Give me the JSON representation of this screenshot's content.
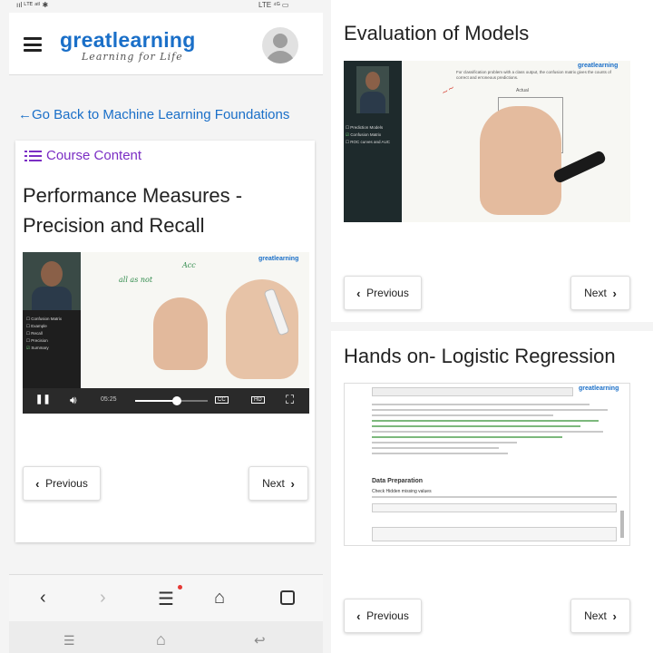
{
  "status_bar": {
    "left": "ııl ᴸᵀᴱ ᵃᵗˡ ✱",
    "right": "LTE ⁴ᴳ ▭"
  },
  "app": {
    "brand_name": "greatlearning",
    "brand_tagline": "Learning for Life",
    "menu_icon": "hamburger-icon",
    "avatar_icon": "user-avatar-icon"
  },
  "back_link": {
    "icon": "arrow-left-icon",
    "label": "Go Back to Machine Learning Foundations"
  },
  "course_content": {
    "icon": "list-icon",
    "label": "Course Content"
  },
  "lesson": {
    "title_line1": "Performance Measures -",
    "title_line2": "Precision and Recall",
    "video": {
      "watermark": "greatlearning",
      "board_text_1": "all as not",
      "board_text_2": "Acc",
      "topics": [
        {
          "label": "Confusion Matrix",
          "done": false
        },
        {
          "label": "Example",
          "done": false
        },
        {
          "label": "Recall",
          "done": false
        },
        {
          "label": "Precision",
          "done": false
        },
        {
          "label": "Summary",
          "done": true
        }
      ],
      "time": "05:25",
      "progress": 0.57,
      "cc_label": "CC",
      "hd_label": "HD"
    },
    "previous_label": "Previous",
    "next_label": "Next"
  },
  "browser_nav": {
    "icons": [
      "back-icon",
      "forward-icon",
      "menu-icon",
      "home-icon",
      "tabs-icon"
    ]
  },
  "right_cards": [
    {
      "title": "Evaluation of Models",
      "watermark": "greatlearning",
      "slide_bullet": "For classification problem with a class output, the confusion matrix gives the counts of correct and erroneous predictions.",
      "slide_heading": "Actual",
      "topics": [
        {
          "label": "Prediction Models",
          "done": false
        },
        {
          "label": "Confusion Matrix",
          "done": true
        },
        {
          "label": "ROC curves and AUC",
          "done": false
        }
      ],
      "previous_label": "Previous",
      "next_label": "Next"
    },
    {
      "title": "Hands on- Logistic Regression",
      "watermark": "greatlearning",
      "section_heading": "Data Preparation",
      "sub_heading": "Check Hidden missing values",
      "previous_label": "Previous",
      "next_label": "Next"
    }
  ],
  "colors": {
    "brand_blue": "#1a6fc8",
    "course_purple": "#7b2ec4",
    "notification_red": "#e53935"
  }
}
